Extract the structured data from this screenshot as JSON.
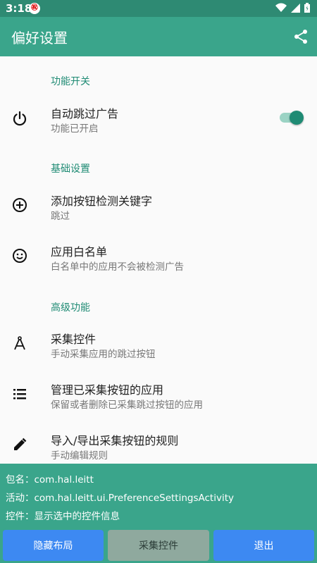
{
  "status_bar": {
    "time": "3:18",
    "notification_icon": "app-notification-icon"
  },
  "app_bar": {
    "title": "偏好设置",
    "share_icon": "share-icon"
  },
  "sections": [
    {
      "header": "功能开关",
      "items": [
        {
          "title": "自动跳过广告",
          "summary": "功能已开启",
          "icon": "power-icon",
          "toggle_on": true
        }
      ]
    },
    {
      "header": "基础设置",
      "items": [
        {
          "title": "添加按钮检测关键字",
          "summary": "跳过",
          "icon": "add-circle-icon"
        },
        {
          "title": "应用白名单",
          "summary": "白名单中的应用不会被检测广告",
          "icon": "smiley-icon"
        }
      ]
    },
    {
      "header": "高级功能",
      "items": [
        {
          "title": "采集控件",
          "summary": "手动采集应用的跳过按钮",
          "icon": "compass-icon"
        },
        {
          "title": "管理已采集按钮的应用",
          "summary": "保留或者删除已采集跳过按钮的应用",
          "icon": "list-icon"
        },
        {
          "title": "导入/导出采集按钮的规则",
          "summary": "手动编辑规则",
          "icon": "edit-icon"
        }
      ]
    }
  ],
  "info": {
    "package": "包名：com.hal.leitt",
    "activity": "活动：com.hal.leitt.ui.PreferenceSettingsActivity",
    "widget": "控件：显示选中的控件信息"
  },
  "buttons": {
    "hide_layout": "隐藏布局",
    "collect_widget": "采集控件",
    "exit": "退出"
  },
  "colors": {
    "app_bar": "#3aa58b",
    "status_bar": "#2e8a73",
    "accent": "#1f8b74",
    "button_blue": "#3d89f2"
  }
}
